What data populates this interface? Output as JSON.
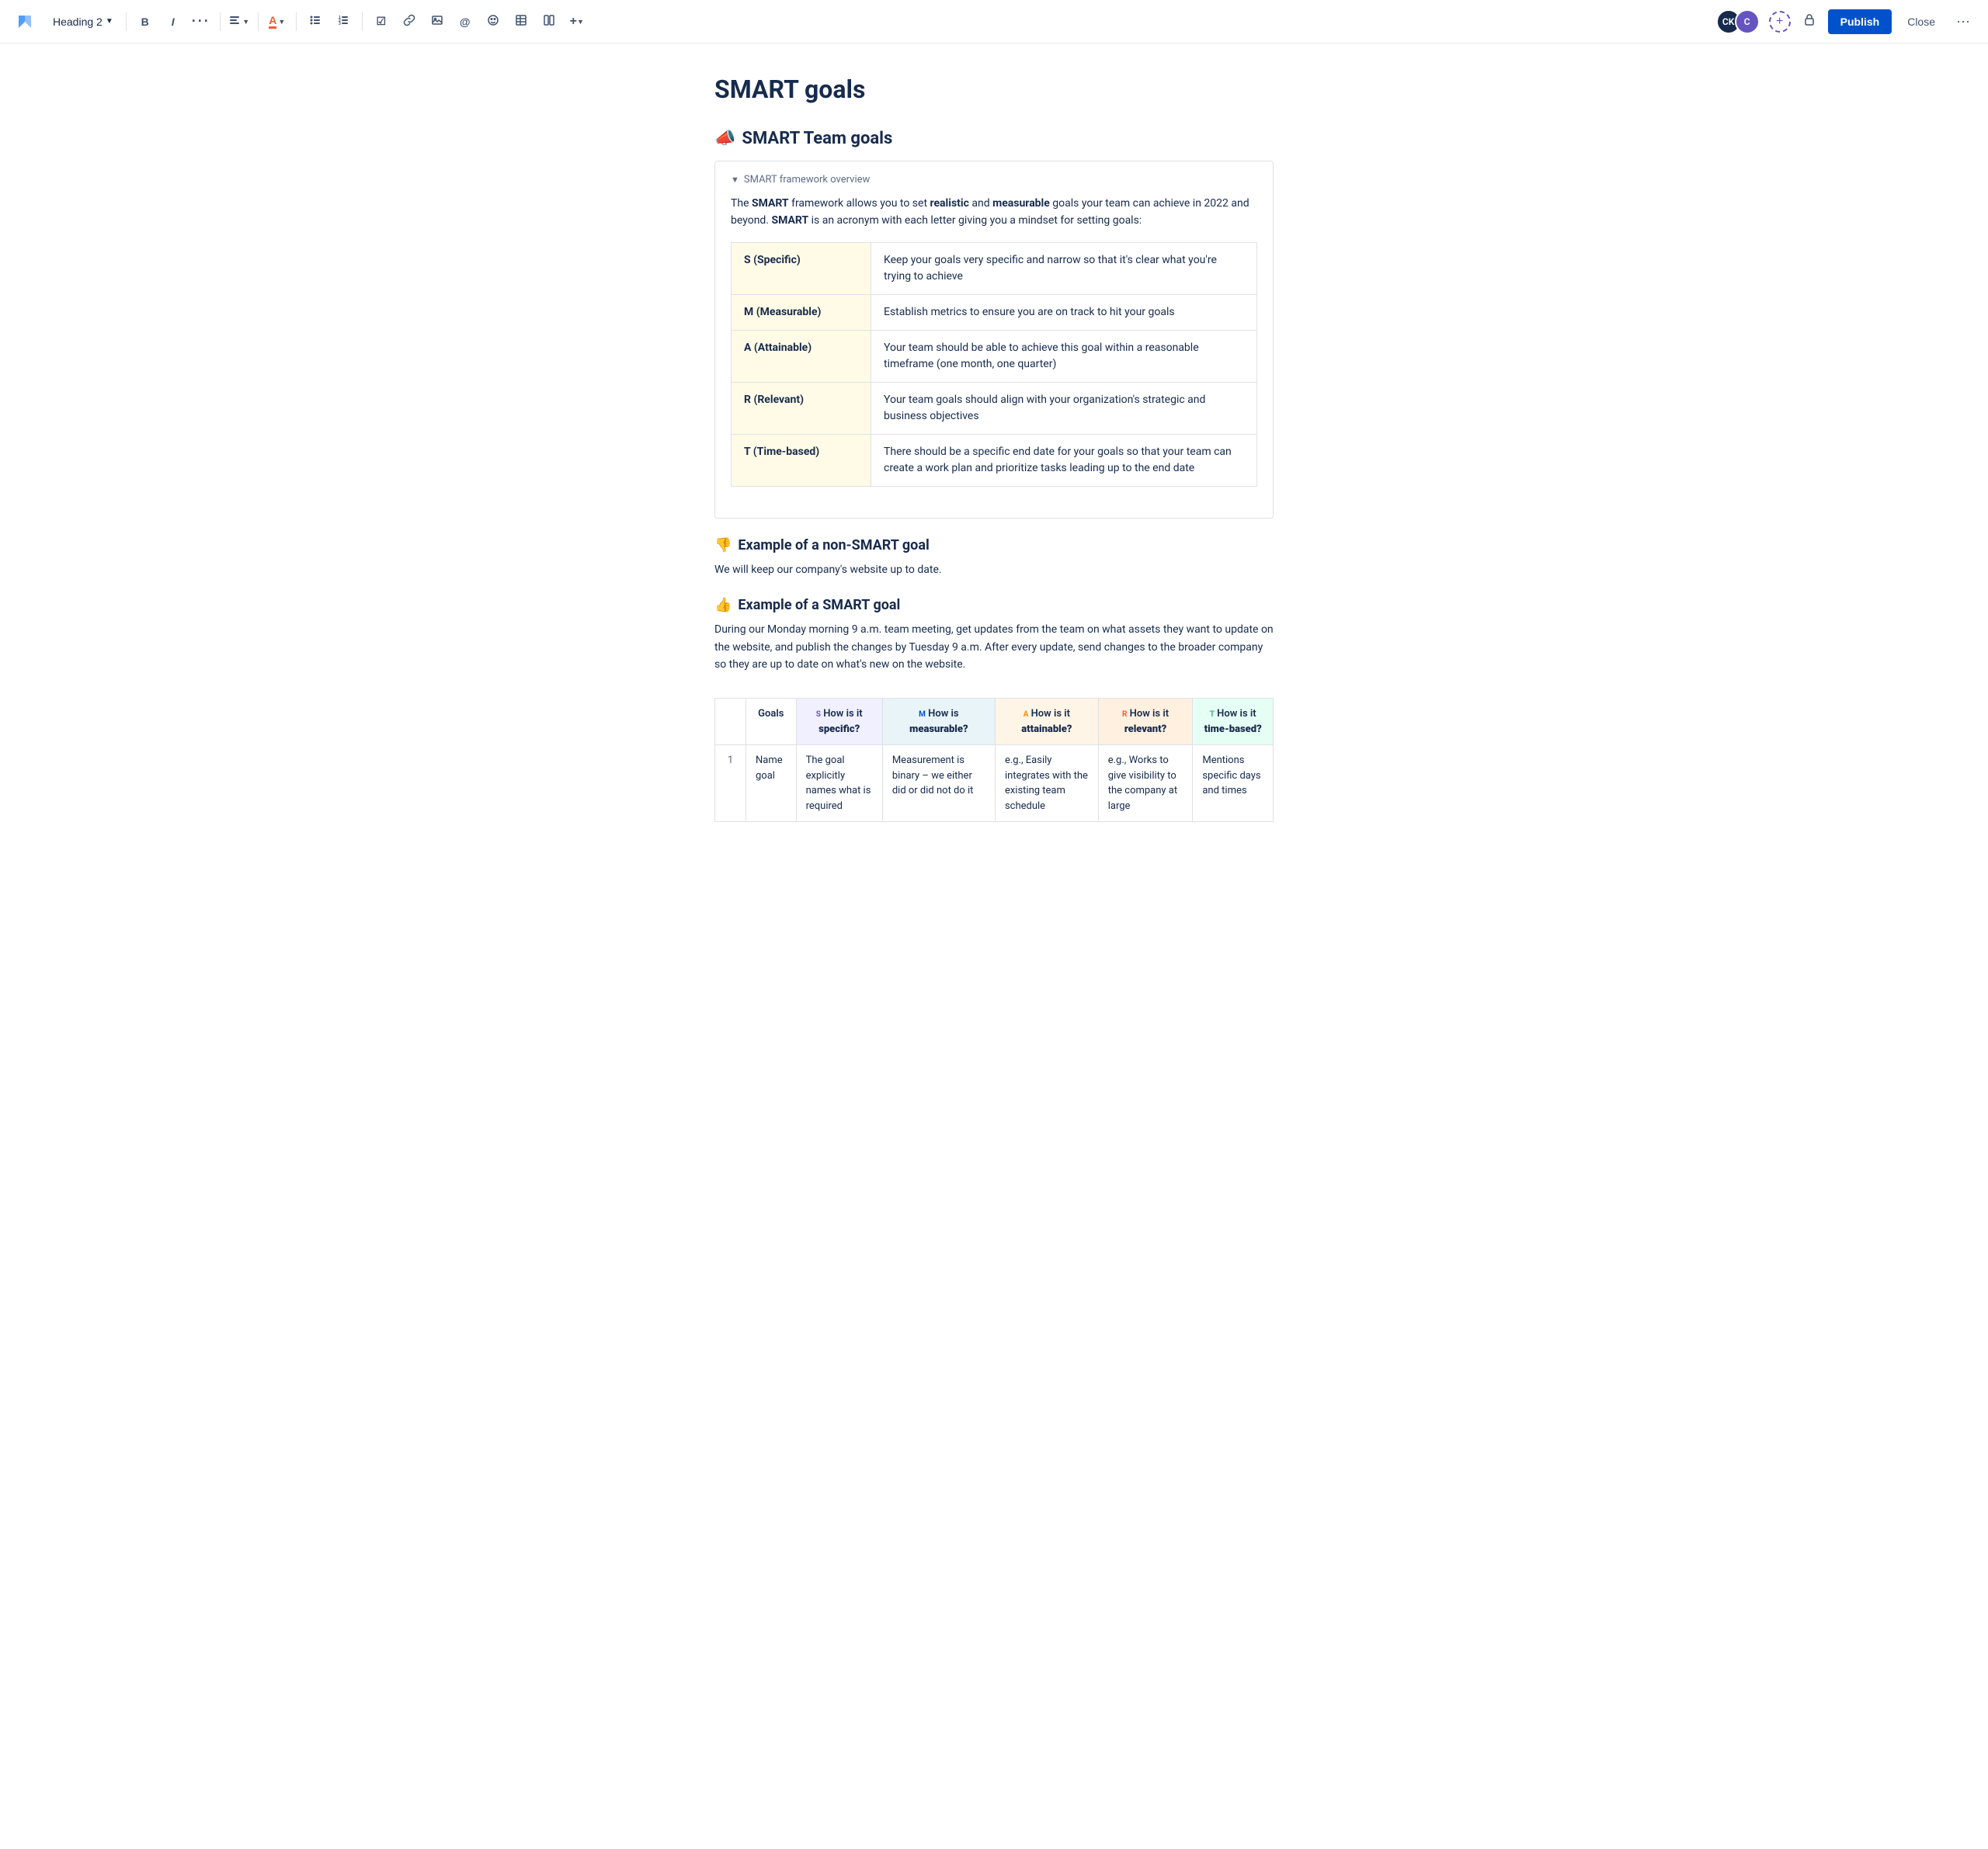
{
  "toolbar": {
    "logo": "✕",
    "heading_label": "Heading 2",
    "bold_label": "B",
    "italic_label": "I",
    "more_format_label": "···",
    "align_label": "≡",
    "color_label": "A",
    "bullet_label": "•",
    "numbered_label": "#",
    "task_label": "☑",
    "link_label": "🔗",
    "image_label": "🖼",
    "mention_label": "@",
    "emoji_label": "☺",
    "table_label": "⊞",
    "layout_label": "⊟",
    "insert_label": "+",
    "avatar_ck_initials": "CK",
    "avatar_c_initials": "C",
    "add_collaborator_label": "+",
    "lock_icon": "🔒",
    "publish_label": "Publish",
    "close_label": "Close",
    "more_label": "···"
  },
  "page": {
    "title": "SMART goals",
    "section1": {
      "heading_icon": "📣",
      "heading": "SMART Team goals",
      "expand_chevron": "▼",
      "expand_label": "SMART framework overview",
      "body_text_parts": [
        {
          "text": "The ",
          "bold": false
        },
        {
          "text": "SMART",
          "bold": true
        },
        {
          "text": " framework allows you to set ",
          "bold": false
        },
        {
          "text": "realistic",
          "bold": true
        },
        {
          "text": " and ",
          "bold": false
        },
        {
          "text": "measurable",
          "bold": true
        },
        {
          "text": " goals your team can achieve in 2022 and beyond. ",
          "bold": false
        },
        {
          "text": "SMART",
          "bold": true
        },
        {
          "text": " is an acronym with each letter giving you a mindset for setting goals:",
          "bold": false
        }
      ],
      "smart_table": [
        {
          "label": "S (Specific)",
          "description": "Keep your goals very specific and narrow so that it's clear what you're trying to achieve"
        },
        {
          "label": "M (Measurable)",
          "description": "Establish metrics to ensure you are on track to hit your goals"
        },
        {
          "label": "A (Attainable)",
          "description": "Your team should be able to achieve this goal within a reasonable timeframe (one month, one quarter)"
        },
        {
          "label": "R (Relevant)",
          "description": "Your team goals should align with your organization's strategic and business objectives"
        },
        {
          "label": "T (Time-based)",
          "description": "There should be a specific end date for your goals so that your team can create a work plan and prioritize tasks leading up to the end date"
        }
      ]
    },
    "non_smart": {
      "icon": "👎",
      "heading": "Example of a non-SMART goal",
      "text": "We will keep our company's website up to date."
    },
    "smart_example": {
      "icon": "👍",
      "heading": "Example of a SMART goal",
      "text": "During our Monday morning 9 a.m. team meeting, get updates from the team on what assets they want to update on the website, and publish the changes by Tuesday 9 a.m. After every update, send changes to the broader company so they are up to date on what's new on the website."
    },
    "goals_table": {
      "columns": [
        {
          "label": "",
          "class": ""
        },
        {
          "label": "Goals",
          "class": "col-goals"
        },
        {
          "label": "How is it specific?",
          "prefix": "s",
          "class": "col-s",
          "prefix_class": "th-s"
        },
        {
          "label": "How is it measurable?",
          "prefix": "M",
          "class": "col-m",
          "prefix_class": "th-m"
        },
        {
          "label": "How is it attainable?",
          "prefix": "A",
          "class": "col-a",
          "prefix_class": "th-a"
        },
        {
          "label": "How is it relevant?",
          "prefix": "R",
          "class": "col-r",
          "prefix_class": "th-r"
        },
        {
          "label": "How is it time-based?",
          "prefix": "T",
          "class": "col-t",
          "prefix_class": "th-t"
        }
      ],
      "rows": [
        {
          "num": "1",
          "goal": "Name goal",
          "specific": "The goal explicitly names what is required",
          "measurable": "Measurement is binary – we either did or did not do it",
          "attainable": "e.g., Easily integrates with the existing team schedule",
          "relevant": "e.g., Works to give visibility to the company at large",
          "time_based": "Mentions specific days and times"
        }
      ]
    }
  }
}
